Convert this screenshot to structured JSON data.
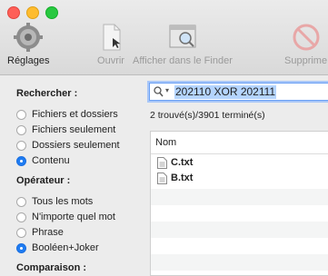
{
  "toolbar": {
    "settings_label": "Réglages",
    "open_label": "Ouvrir",
    "finder_label": "Afficher dans le Finder",
    "delete_label": "Supprime"
  },
  "search_section": {
    "title": "Rechercher :",
    "options": [
      "Fichiers et dossiers",
      "Fichiers seulement",
      "Dossiers seulement",
      "Contenu"
    ],
    "selected": "Contenu"
  },
  "operator_section": {
    "title": "Opérateur :",
    "options": [
      "Tous les mots",
      "N'importe quel mot",
      "Phrase",
      "Booléen+Joker"
    ],
    "selected": "Booléen+Joker"
  },
  "comparison_section": {
    "title": "Comparaison :"
  },
  "search": {
    "value": "202110 XOR 202111"
  },
  "status": "2 trouvé(s)/3901 terminé(s)",
  "results": {
    "column_name": "Nom",
    "files": [
      "C.txt",
      "B.txt"
    ]
  }
}
